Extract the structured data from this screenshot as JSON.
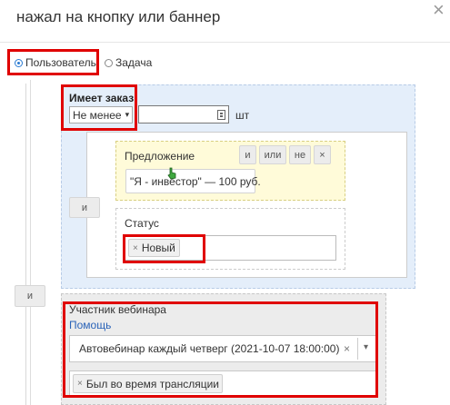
{
  "dialog": {
    "title": "нажал на кнопку или баннер",
    "close_label": "×"
  },
  "target_radio": {
    "options": [
      {
        "label": "Пользователь",
        "selected": true
      },
      {
        "label": "Задача",
        "selected": false
      }
    ]
  },
  "conditions": {
    "outer_and_label": "и",
    "has_order": {
      "label": "Имеет заказ",
      "comparator": "Не менее",
      "quantity_value": "",
      "unit": "шт",
      "and_label": "и",
      "offer": {
        "label": "Предложение",
        "buttons": [
          "и",
          "или",
          "не",
          "×"
        ],
        "value": "\"Я - инвестор\" — 100 руб."
      },
      "status": {
        "label": "Статус",
        "tag": "Новый",
        "tag_remove": "×"
      }
    },
    "webinar": {
      "label": "Участник вебинара",
      "help_link": "Помощь",
      "selected_webinar": "Автовебинар каждый четверг (2021-10-07 18:00:00)",
      "clear": "×",
      "arrow": "▾",
      "tag": "Был во время трансляции",
      "tag_remove": "×"
    }
  },
  "colors": {
    "highlight": "#e00000",
    "block_blue": "#e4eefa",
    "block_yellow": "#fffbd9",
    "link": "#2a63b8"
  }
}
